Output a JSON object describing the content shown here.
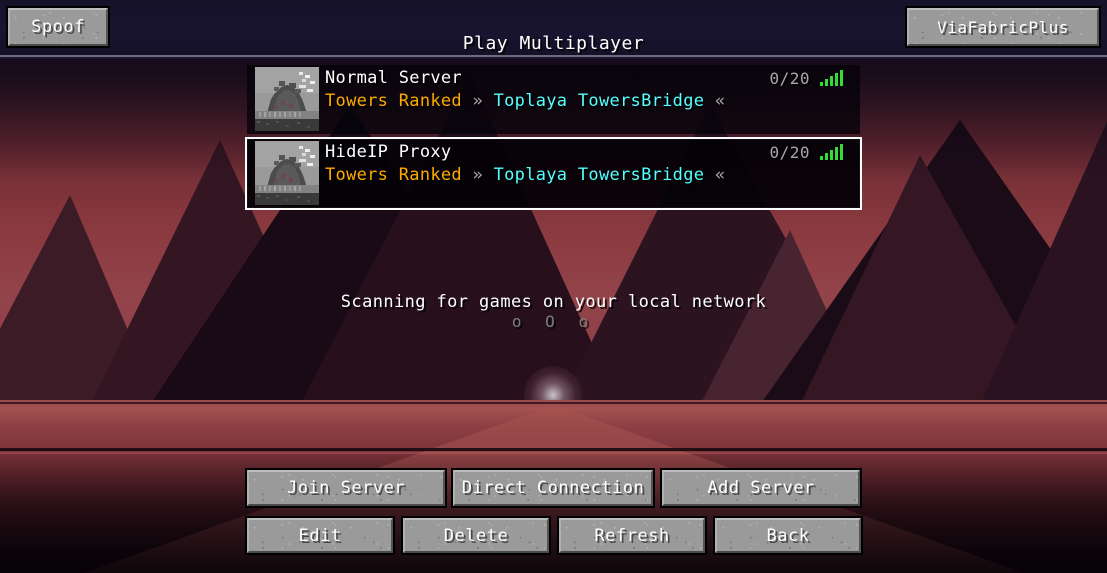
{
  "window": {
    "title": "Play Multiplayer"
  },
  "topbar": {
    "spoof_label": "Spoof",
    "viafabricplus_label": "ViaFabricPlus"
  },
  "server_list": {
    "entries": [
      {
        "name": "Normal Server",
        "motd_part1": "Towers Ranked",
        "motd_sep1": "»",
        "motd_part2": "Toplaya TowersBridge",
        "motd_sep2": "«",
        "players": "0/20",
        "ping_icon": "signal-bars-icon",
        "ping_bars": 5,
        "selected": false,
        "icon": "server-thumbnail"
      },
      {
        "name": "HideIP Proxy",
        "motd_part1": "Towers Ranked",
        "motd_sep1": "»",
        "motd_part2": "Toplaya TowersBridge",
        "motd_sep2": "«",
        "players": "0/20",
        "ping_icon": "signal-bars-icon",
        "ping_bars": 5,
        "selected": true,
        "icon": "server-thumbnail"
      }
    ]
  },
  "lan": {
    "scanning_text": "Scanning for games on your local network",
    "loading_dots": "o O o"
  },
  "buttons": {
    "join_server": "Join Server",
    "direct_connection": "Direct Connection",
    "add_server": "Add Server",
    "edit": "Edit",
    "delete": "Delete",
    "refresh": "Refresh",
    "back": "Back"
  },
  "colors": {
    "motd_gold": "#ffaa00",
    "motd_aqua": "#55ffff",
    "motd_gray": "#aaaaaa",
    "ping_green": "#33dd33",
    "text_white": "#ffffff",
    "player_count_gray": "#a8a8a8",
    "button_face": "#9a9a9a",
    "topbar_bg": "#15112a",
    "background_accent": "#8a3a3f"
  }
}
